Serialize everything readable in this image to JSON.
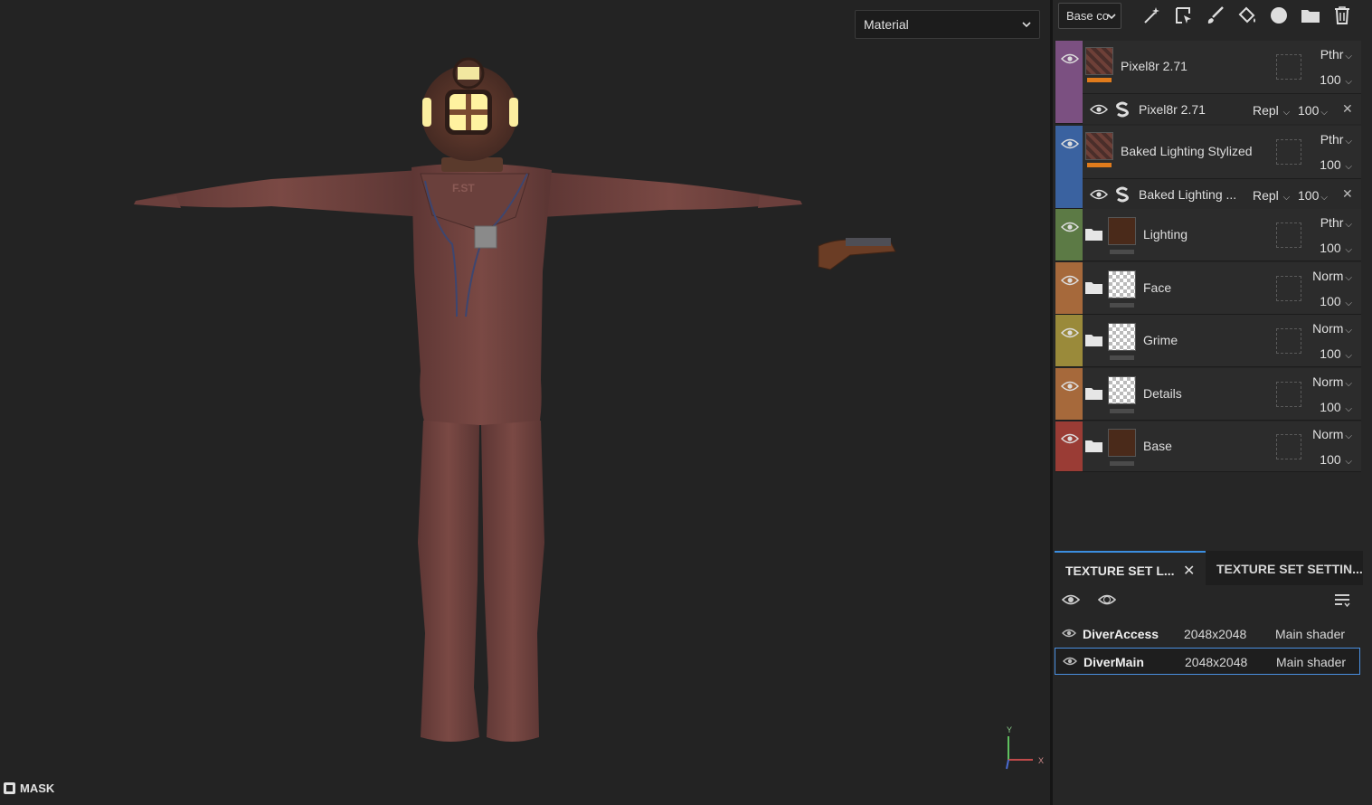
{
  "viewport": {
    "mode_dropdown": "Material",
    "mask_label": "MASK",
    "gizmo": {
      "y_label": "Y",
      "x_label": "X"
    }
  },
  "toolbar": {
    "channel_select": "Base co",
    "icons": [
      "magic-wand-icon",
      "fill-projection-icon",
      "brush-icon",
      "fill-bucket-icon",
      "smart-material-icon",
      "folder-icon",
      "trash-icon"
    ]
  },
  "layers": [
    {
      "name": "Pixel8r 2.71",
      "color": "#7b5081",
      "blend": "Pthr",
      "opacity": "100",
      "sub": {
        "name": "Pixel8r 2.71",
        "blend": "Repl",
        "opacity": "100"
      }
    },
    {
      "name": "Baked Lighting Stylized",
      "color": "#3a62a0",
      "blend": "Pthr",
      "opacity": "100",
      "sub": {
        "name": "Baked Lighting ...",
        "blend": "Repl",
        "opacity": "100"
      }
    },
    {
      "name": "Lighting",
      "color": "#5c7a45",
      "blend": "Pthr",
      "opacity": "100"
    },
    {
      "name": "Face",
      "color": "#a6693b",
      "blend": "Norm",
      "opacity": "100"
    },
    {
      "name": "Grime",
      "color": "#9a8a3a",
      "blend": "Norm",
      "opacity": "100"
    },
    {
      "name": "Details",
      "color": "#a6693b",
      "blend": "Norm",
      "opacity": "100"
    },
    {
      "name": "Base",
      "color": "#9a3c35",
      "blend": "Norm",
      "opacity": "100"
    }
  ],
  "texture_sets": {
    "tab_active": "TEXTURE SET L...",
    "tab_inactive": "TEXTURE SET SETTIN...",
    "rows": [
      {
        "name": "DiverAccess",
        "resolution": "2048x2048",
        "shader": "Main shader"
      },
      {
        "name": "DiverMain",
        "resolution": "2048x2048",
        "shader": "Main shader",
        "selected": true
      }
    ]
  }
}
